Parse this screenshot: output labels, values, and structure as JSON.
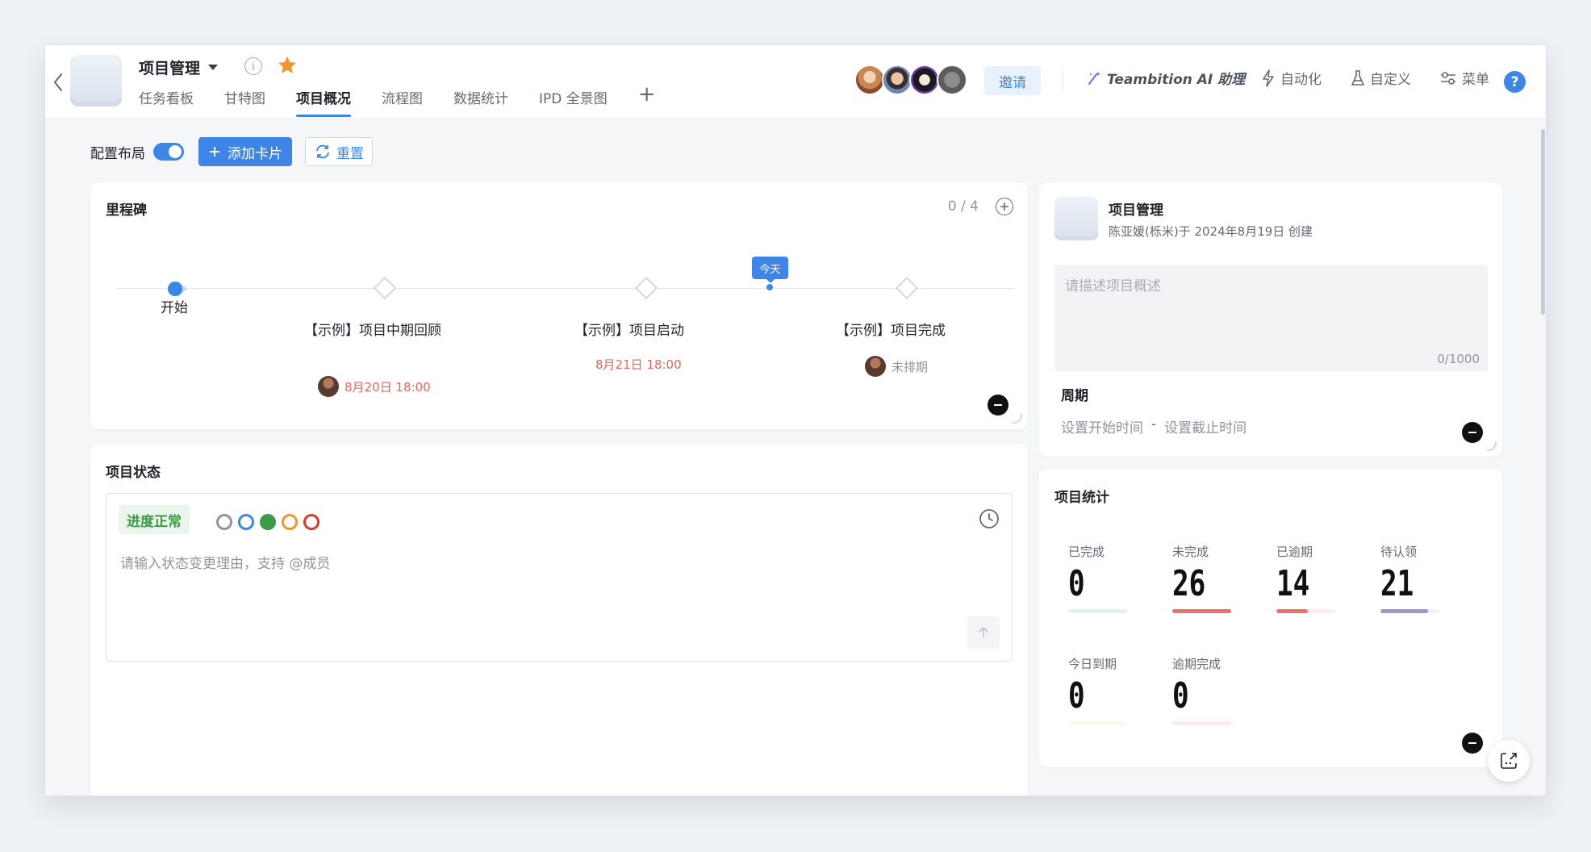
{
  "header": {
    "project_title": "项目管理",
    "tabs": [
      {
        "label": "任务看板"
      },
      {
        "label": "甘特图"
      },
      {
        "label": "项目概况",
        "active": true
      },
      {
        "label": "流程图"
      },
      {
        "label": "数据统计"
      },
      {
        "label": "IPD 全景图"
      }
    ],
    "add_tab": "+",
    "invite_label": "邀请",
    "ai_label": "Teambition AI 助理",
    "automation_label": "自动化",
    "custom_label": "自定义",
    "menu_label": "菜单",
    "help_label": "?",
    "icons": {
      "back": "chevron-left-icon",
      "info": "info-icon",
      "star": "star-icon",
      "ai": "magic-wand-icon",
      "automation": "lightning-icon",
      "custom": "flask-icon",
      "menu": "sliders-icon"
    }
  },
  "toolbar": {
    "layout_label": "配置布局",
    "layout_enabled": true,
    "add_card_label": "添加卡片",
    "reset_label": "重置"
  },
  "milestones": {
    "title": "里程碑",
    "count": "0 / 4",
    "today_label": "今天",
    "items": [
      {
        "label": "开始"
      },
      {
        "label": "【示例】项目中期回顾",
        "date": "8月20日 18:00"
      },
      {
        "label": "【示例】项目启动",
        "date": "8月21日 18:00"
      },
      {
        "label": "【示例】项目完成",
        "date": "未排期"
      }
    ]
  },
  "status": {
    "title": "项目状态",
    "tag": "进度正常",
    "dot_colors": [
      "#8f959e",
      "#3d86e6",
      "#3c9b4a",
      "#f0962f",
      "#d93a2b"
    ],
    "placeholder": "请输入状态变更理由，支持 @成员"
  },
  "info": {
    "name": "项目管理",
    "creator": "陈亚媛(栎米)于 2024年8月19日 创建",
    "description_placeholder": "请描述项目概述",
    "description_count": "0/1000",
    "period_title": "周期",
    "start_placeholder": "设置开始时间",
    "dash": "-",
    "end_placeholder": "设置截止时间"
  },
  "stats": {
    "title": "项目统计",
    "items": [
      {
        "label": "已完成",
        "value": "0",
        "color": "#3c9b4a",
        "fraction": 0
      },
      {
        "label": "未完成",
        "value": "26",
        "color": "#e8736a",
        "fraction": 1.0
      },
      {
        "label": "已逾期",
        "value": "14",
        "color": "#e8736a",
        "fraction": 0.54
      },
      {
        "label": "待认领",
        "value": "21",
        "color": "#9b96d8",
        "fraction": 0.81
      },
      {
        "label": "今日到期",
        "value": "0",
        "color": "#e8c46a",
        "fraction": 0
      },
      {
        "label": "逾期完成",
        "value": "0",
        "color": "#e8736a",
        "fraction": 0
      }
    ]
  },
  "colors": {
    "accent": "#3d86e6",
    "danger": "#e0685c",
    "success": "#3c9b4a"
  }
}
